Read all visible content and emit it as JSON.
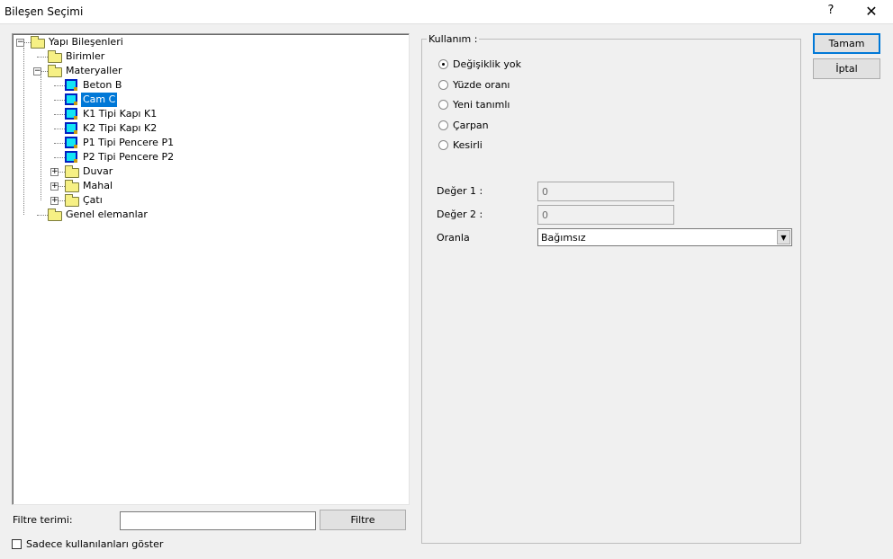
{
  "window": {
    "title": "Bileşen Seçimi",
    "help_label": "?",
    "close_label": "✕"
  },
  "tree": {
    "items": [
      {
        "label": "Yapı Bileşenleri",
        "level": 0,
        "icon": "folder-icon",
        "expander": "−"
      },
      {
        "label": "Birimler",
        "level": 1,
        "icon": "folder-icon"
      },
      {
        "label": "Materyaller",
        "level": 1,
        "icon": "folder-icon",
        "expander": "−"
      },
      {
        "label": "Beton  B",
        "level": 2,
        "icon": "cube-icon"
      },
      {
        "label": "Cam  C",
        "level": 2,
        "icon": "cube-icon",
        "selected": true
      },
      {
        "label": "K1 Tipi Kapı  K1",
        "level": 2,
        "icon": "cube-icon"
      },
      {
        "label": "K2 Tipi Kapı  K2",
        "level": 2,
        "icon": "cube-icon"
      },
      {
        "label": "P1 Tipi Pencere  P1",
        "level": 2,
        "icon": "cube-icon"
      },
      {
        "label": "P2 Tipi Pencere  P2",
        "level": 2,
        "icon": "cube-icon"
      },
      {
        "label": "Duvar",
        "level": 2,
        "icon": "folder-icon",
        "expander": "+"
      },
      {
        "label": "Mahal",
        "level": 2,
        "icon": "folder-icon",
        "expander": "+"
      },
      {
        "label": "Çatı",
        "level": 2,
        "icon": "folder-icon",
        "expander": "+"
      },
      {
        "label": "Genel elemanlar",
        "level": 1,
        "icon": "folder-icon"
      }
    ]
  },
  "filter": {
    "label": "Filtre terimi:",
    "value": "",
    "button": "Filtre"
  },
  "show_used": {
    "label": "Sadece kullanılanları göster",
    "checked": false
  },
  "usage": {
    "group_label": "Kullanım :",
    "options": [
      {
        "label": "Değişiklik yok",
        "checked": true
      },
      {
        "label": "Yüzde oranı",
        "checked": false
      },
      {
        "label": "Yeni tanımlı",
        "checked": false
      },
      {
        "label": "Çarpan",
        "checked": false
      },
      {
        "label": "Kesirli",
        "checked": false
      }
    ],
    "value1_label": "Değer 1 :",
    "value1": "0",
    "value2_label": "Değer 2 :",
    "value2": "0",
    "ratio_label": "Oranla",
    "ratio_value": "Bağımsız"
  },
  "buttons": {
    "ok": "Tamam",
    "cancel": "İptal"
  }
}
